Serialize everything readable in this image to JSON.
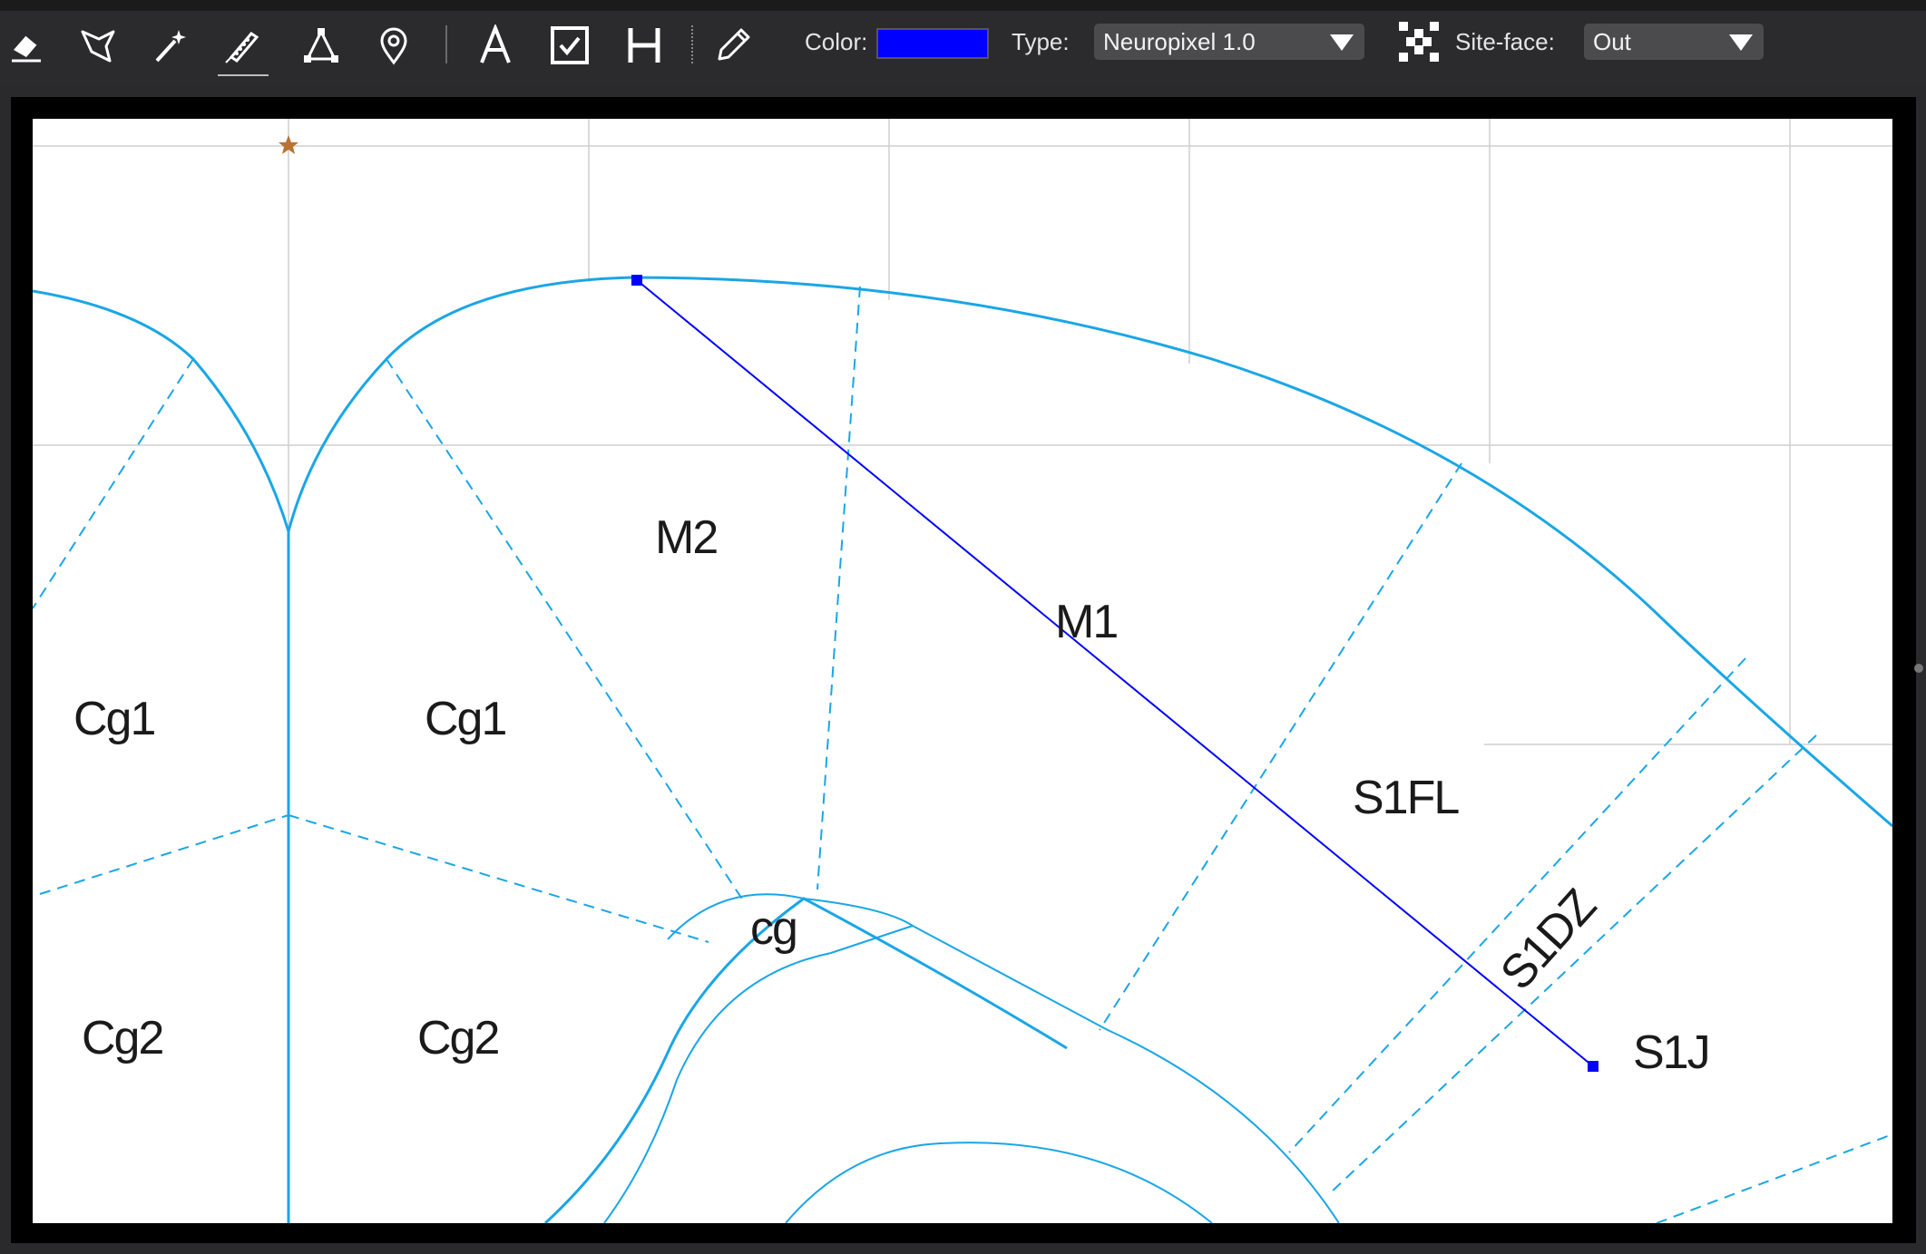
{
  "toolbar": {
    "tools": [
      {
        "name": "eraser-tool",
        "icon": "eraser-icon"
      },
      {
        "name": "lasso-tool",
        "icon": "lasso-icon"
      },
      {
        "name": "magic-wand-tool",
        "icon": "magic-wand-icon"
      },
      {
        "name": "probe-tool",
        "icon": "probe-icon",
        "active": true
      },
      {
        "name": "triangle-tool",
        "icon": "triangle-points-icon"
      },
      {
        "name": "marker-tool",
        "icon": "map-pin-icon"
      },
      {
        "name": "text-tool",
        "icon": "text-a-icon"
      },
      {
        "name": "checkbox-tool",
        "icon": "checkbox-icon"
      },
      {
        "name": "h-tool",
        "icon": "h-letter-icon"
      },
      {
        "name": "pencil-tool",
        "icon": "pencil-icon"
      }
    ],
    "color_label": "Color:",
    "color_value": "#0000ff",
    "type_label": "Type:",
    "type_value": "Neuropixel 1.0",
    "siteface_label": "Site-face:",
    "siteface_value": "Out",
    "siteface_icon": "checker-pattern-icon"
  },
  "colors": {
    "boundary": "#1aa6e6",
    "probe": "#0000ff",
    "star": "#b87333",
    "grid": "#cfcfcf"
  },
  "regions": {
    "m2": "M2",
    "m1": "M1",
    "cg1_left": "Cg1",
    "cg1_right": "Cg1",
    "cg2_left": "Cg2",
    "cg2_right": "Cg2",
    "cg": "cg",
    "s1fl": "S1FL",
    "s1dz": "S1DZ",
    "s1j": "S1J"
  }
}
